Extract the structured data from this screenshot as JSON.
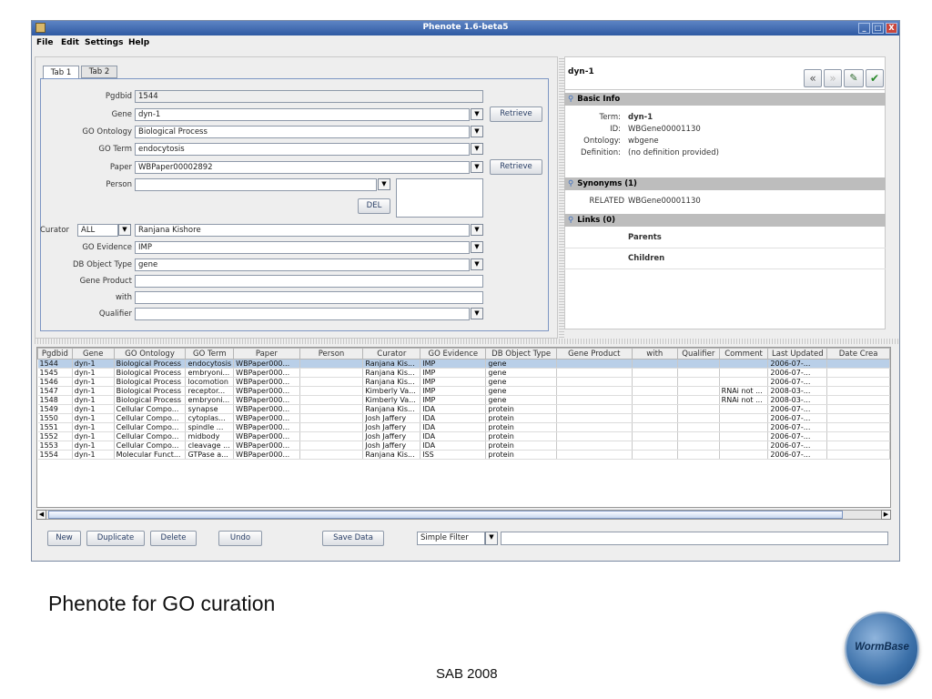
{
  "window": {
    "title": "Phenote 1.6-beta5",
    "controls": [
      "_",
      "□",
      "X"
    ]
  },
  "menu": [
    "File",
    "Edit",
    "Settings",
    "Help"
  ],
  "tabs": [
    "Tab 1",
    "Tab 2"
  ],
  "form": {
    "pgdbid": {
      "label": "Pgdbid",
      "value": "1544"
    },
    "gene": {
      "label": "Gene",
      "value": "dyn-1"
    },
    "go_ontology": {
      "label": "GO Ontology",
      "value": "Biological Process"
    },
    "go_term": {
      "label": "GO Term",
      "value": "endocytosis"
    },
    "paper": {
      "label": "Paper",
      "value": "WBPaper00002892"
    },
    "person": {
      "label": "Person",
      "value": ""
    },
    "curator": {
      "label": "Curator",
      "filter": "ALL",
      "value": "Ranjana Kishore"
    },
    "go_evidence": {
      "label": "GO Evidence",
      "value": "IMP"
    },
    "db_object_type": {
      "label": "DB Object Type",
      "value": "gene"
    },
    "gene_product": {
      "label": "Gene Product",
      "value": ""
    },
    "with": {
      "label": "with",
      "value": ""
    },
    "qualifier": {
      "label": "Qualifier",
      "value": ""
    },
    "retrieve_label": "Retrieve",
    "del_label": "DEL"
  },
  "info": {
    "title": "dyn-1",
    "basic_header": "Basic Info",
    "term_label": "Term:",
    "term_value": "dyn-1",
    "id_label": "ID:",
    "id_value": "WBGene00001130",
    "ontology_label": "Ontology:",
    "ontology_value": "wbgene",
    "definition_label": "Definition:",
    "definition_value": "(no definition provided)",
    "synonyms_header": "Synonyms (1)",
    "synonym_type": "RELATED",
    "synonym_value": "WBGene00001130",
    "links_header": "Links (0)",
    "parents": "Parents",
    "children": "Children"
  },
  "table": {
    "columns": [
      "Pgdbid",
      "Gene",
      "GO Ontology",
      "GO Term",
      "Paper",
      "Person",
      "Curator",
      "GO Evidence",
      "DB Object Type",
      "Gene Product",
      "with",
      "Qualifier",
      "Comment",
      "Last Updated",
      "Date Crea"
    ],
    "rows": [
      [
        "1544",
        "dyn-1",
        "Biological Process",
        "endocytosis",
        "WBPaper000...",
        "",
        "Ranjana Kis...",
        "IMP",
        "gene",
        "",
        "",
        "",
        "",
        "2006-07-...",
        ""
      ],
      [
        "1545",
        "dyn-1",
        "Biological Process",
        "embryoni...",
        "WBPaper000...",
        "",
        "Ranjana Kis...",
        "IMP",
        "gene",
        "",
        "",
        "",
        "",
        "2006-07-...",
        ""
      ],
      [
        "1546",
        "dyn-1",
        "Biological Process",
        "locomotion",
        "WBPaper000...",
        "",
        "Ranjana Kis...",
        "IMP",
        "gene",
        "",
        "",
        "",
        "",
        "2006-07-...",
        ""
      ],
      [
        "1547",
        "dyn-1",
        "Biological Process",
        "receptor...",
        "WBPaper000...",
        "",
        "Kimberly Va...",
        "IMP",
        "gene",
        "",
        "",
        "",
        "RNAi not ...",
        "2008-03-...",
        ""
      ],
      [
        "1548",
        "dyn-1",
        "Biological Process",
        "embryoni...",
        "WBPaper000...",
        "",
        "Kimberly Va...",
        "IMP",
        "gene",
        "",
        "",
        "",
        "RNAi not ...",
        "2008-03-...",
        ""
      ],
      [
        "1549",
        "dyn-1",
        "Cellular Compo...",
        "synapse",
        "WBPaper000...",
        "",
        "Ranjana Kis...",
        "IDA",
        "protein",
        "",
        "",
        "",
        "",
        "2006-07-...",
        ""
      ],
      [
        "1550",
        "dyn-1",
        "Cellular Compo...",
        "cytoplas...",
        "WBPaper000...",
        "",
        "Josh Jaffery",
        "IDA",
        "protein",
        "",
        "",
        "",
        "",
        "2006-07-...",
        ""
      ],
      [
        "1551",
        "dyn-1",
        "Cellular Compo...",
        "spindle ...",
        "WBPaper000...",
        "",
        "Josh Jaffery",
        "IDA",
        "protein",
        "",
        "",
        "",
        "",
        "2006-07-...",
        ""
      ],
      [
        "1552",
        "dyn-1",
        "Cellular Compo...",
        "midbody",
        "WBPaper000...",
        "",
        "Josh Jaffery",
        "IDA",
        "protein",
        "",
        "",
        "",
        "",
        "2006-07-...",
        ""
      ],
      [
        "1553",
        "dyn-1",
        "Cellular Compo...",
        "cleavage ...",
        "WBPaper000...",
        "",
        "Josh Jaffery",
        "IDA",
        "protein",
        "",
        "",
        "",
        "",
        "2006-07-...",
        ""
      ],
      [
        "1554",
        "dyn-1",
        "Molecular Funct...",
        "GTPase a...",
        "WBPaper000...",
        "",
        "Ranjana Kis...",
        "ISS",
        "protein",
        "",
        "",
        "",
        "",
        "2006-07-...",
        ""
      ]
    ],
    "selected_row": 0
  },
  "buttons": {
    "new": "New",
    "duplicate": "Duplicate",
    "delete": "Delete",
    "undo": "Undo",
    "save": "Save Data",
    "filter": "Simple Filter"
  },
  "slide": {
    "caption": "Phenote for GO curation",
    "footer": "SAB 2008",
    "logo": "WormBase"
  },
  "colors": {
    "titlebar": "#2f5aa3",
    "selection": "#b9cfe8",
    "section": "#bdbdbd",
    "logo": "#3a6fa8"
  }
}
